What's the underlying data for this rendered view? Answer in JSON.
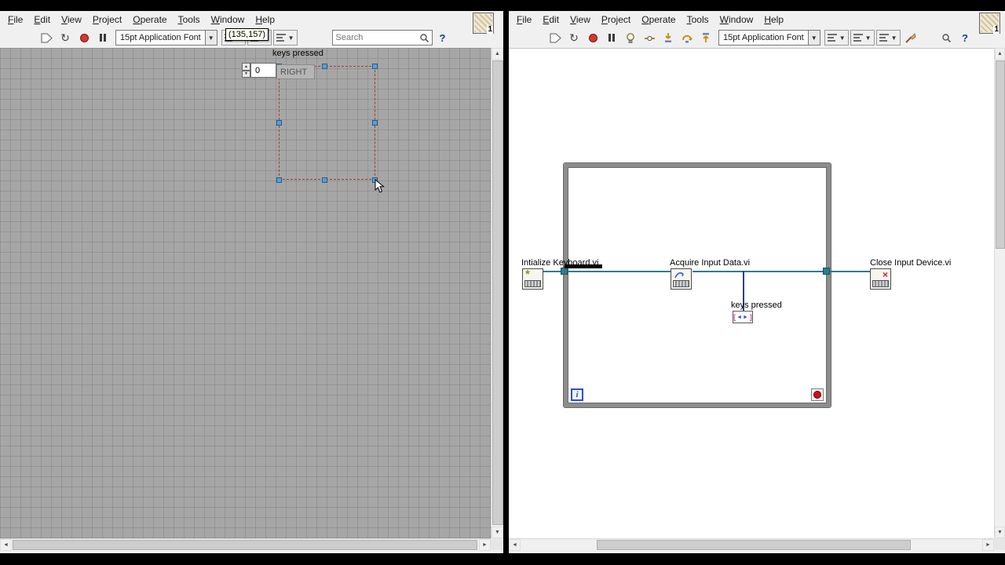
{
  "left_window": {
    "menu": [
      "File",
      "Edit",
      "View",
      "Project",
      "Operate",
      "Tools",
      "Window",
      "Help"
    ],
    "toolbar": {
      "font": "15pt Application Font",
      "search_placeholder": "Search",
      "help": "?"
    },
    "tooltip": "(135,157)",
    "icon_badge": "1",
    "panel": {
      "indicator_label": "keys pressed",
      "numeric_value": "0",
      "item_text": "RIGHT"
    }
  },
  "right_window": {
    "menu": [
      "File",
      "Edit",
      "View",
      "Project",
      "Operate",
      "Tools",
      "Window",
      "Help"
    ],
    "toolbar": {
      "font": "15pt Application Font",
      "help": "?"
    },
    "icon_badge": "1",
    "diagram": {
      "init_label": "Intialize Keyboard.vi",
      "acquire_label": "Acquire Input Data.vi",
      "close_label": "Close Input Device.vi",
      "indicator_label": "keys pressed",
      "iteration_label": "i"
    }
  }
}
